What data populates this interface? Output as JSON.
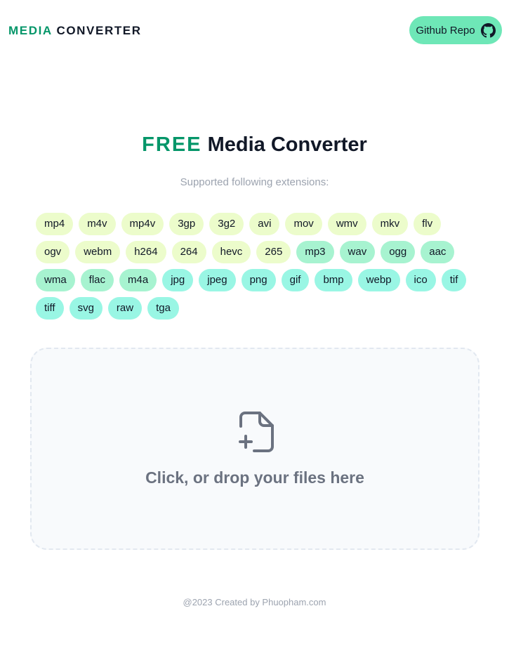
{
  "nav": {
    "logo_accent": "MEDIA",
    "logo_rest": "CONVERTER",
    "repo_label": "Github Repo",
    "repo_icon": "github-icon"
  },
  "hero": {
    "title_accent": "FREE",
    "title_rest": "Media Converter",
    "subtitle": "Supported following extensions:"
  },
  "extensions": {
    "video": [
      "mp4",
      "m4v",
      "mp4v",
      "3gp",
      "3g2",
      "avi",
      "mov",
      "wmv",
      "mkv",
      "flv",
      "ogv",
      "webm",
      "h264",
      "264",
      "hevc",
      "265"
    ],
    "audio": [
      "mp3",
      "wav",
      "ogg",
      "aac",
      "wma",
      "flac",
      "m4a"
    ],
    "image": [
      "jpg",
      "jpeg",
      "png",
      "gif",
      "bmp",
      "webp",
      "ico",
      "tif",
      "tiff",
      "svg",
      "raw",
      "tga"
    ]
  },
  "dropzone": {
    "icon": "file-plus-icon",
    "label": "Click, or drop your files here"
  },
  "footer": {
    "text": "@2023 Created by Phuopham.com"
  },
  "colors": {
    "brand": "#059669",
    "repo_button": "#6ee7b7",
    "video_tag": "#ecfccb",
    "audio_tag": "#a7f3d0",
    "image_tag": "#99f6e4"
  }
}
